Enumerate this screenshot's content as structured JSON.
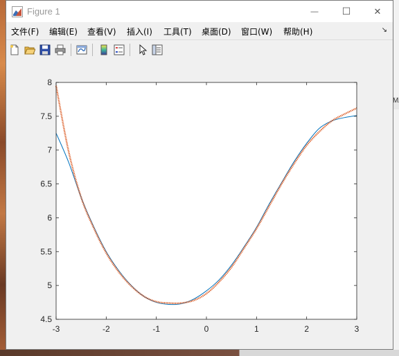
{
  "window": {
    "title": "Figure 1",
    "controls": {
      "minimize": "—",
      "maximize": "☐",
      "close": "✕"
    }
  },
  "menubar": {
    "items": [
      {
        "label": "文件(F)"
      },
      {
        "label": "编辑(E)"
      },
      {
        "label": "查看(V)"
      },
      {
        "label": "插入(I)"
      },
      {
        "label": "工具(T)"
      },
      {
        "label": "桌面(D)"
      },
      {
        "label": "窗口(W)"
      },
      {
        "label": "帮助(H)"
      }
    ],
    "overflow_arrow": "↘"
  },
  "toolbar": {
    "buttons": [
      {
        "icon": "new-figure-icon"
      },
      {
        "icon": "open-file-icon"
      },
      {
        "icon": "save-icon"
      },
      {
        "icon": "print-icon"
      },
      {
        "icon": "link-plot-icon"
      },
      {
        "icon": "insert-colorbar-icon"
      },
      {
        "icon": "insert-legend-icon"
      },
      {
        "icon": "edit-plot-icon"
      },
      {
        "icon": "property-inspector-icon"
      }
    ]
  },
  "background_strip_text": "MA",
  "chart_data": {
    "type": "line",
    "xlim": [
      -3,
      3
    ],
    "ylim": [
      4.5,
      8
    ],
    "xticks": [
      "-3",
      "-2",
      "-1",
      "0",
      "1",
      "2",
      "3"
    ],
    "yticks": [
      "4.5",
      "5",
      "5.5",
      "6",
      "6.5",
      "7",
      "7.5",
      "8"
    ],
    "grid": false,
    "series": [
      {
        "color": "#0072BD",
        "style": "solid",
        "x": [
          -3,
          -2.75,
          -2.5,
          -2.25,
          -2,
          -1.75,
          -1.5,
          -1.25,
          -1,
          -0.75,
          -0.5,
          -0.25,
          0,
          0.25,
          0.5,
          0.75,
          1,
          1.25,
          1.5,
          1.75,
          2,
          2.25,
          2.5,
          2.75,
          3
        ],
        "y": [
          7.25,
          6.82,
          6.3,
          5.87,
          5.5,
          5.22,
          5.0,
          4.84,
          4.75,
          4.72,
          4.73,
          4.8,
          4.92,
          5.08,
          5.3,
          5.57,
          5.86,
          6.2,
          6.52,
          6.83,
          7.1,
          7.32,
          7.43,
          7.48,
          7.51
        ]
      },
      {
        "color": "#D95319",
        "style": "dotted",
        "x": [
          -3,
          -2.75,
          -2.5,
          -2.25,
          -2,
          -1.75,
          -1.5,
          -1.25,
          -1,
          -0.75,
          -0.5,
          -0.25,
          0,
          0.25,
          0.5,
          0.75,
          1,
          1.25,
          1.5,
          1.75,
          2,
          2.25,
          2.5,
          2.75,
          3
        ],
        "y": [
          7.95,
          6.98,
          6.3,
          5.85,
          5.48,
          5.2,
          4.99,
          4.84,
          4.76,
          4.74,
          4.74,
          4.78,
          4.88,
          5.05,
          5.27,
          5.55,
          5.84,
          6.17,
          6.5,
          6.8,
          7.07,
          7.27,
          7.43,
          7.53,
          7.62
        ]
      }
    ]
  }
}
